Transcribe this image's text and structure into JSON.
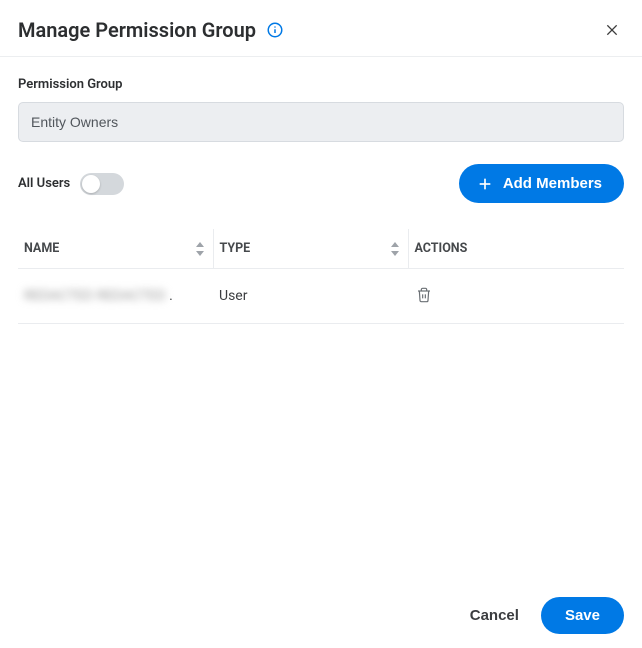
{
  "header": {
    "title": "Manage Permission Group",
    "info_icon_name": "info-icon",
    "close_icon_name": "close-icon"
  },
  "form": {
    "permission_group_label": "Permission Group",
    "permission_group_value": "Entity Owners",
    "all_users_label": "All Users",
    "all_users_on": false,
    "add_members_label": "Add Members"
  },
  "table": {
    "columns": {
      "name": "NAME",
      "type": "TYPE",
      "actions": "ACTIONS"
    },
    "rows": [
      {
        "name": "REDACTED REDACTED",
        "type": "User"
      }
    ]
  },
  "footer": {
    "cancel": "Cancel",
    "save": "Save"
  },
  "colors": {
    "primary": "#0079e5"
  }
}
